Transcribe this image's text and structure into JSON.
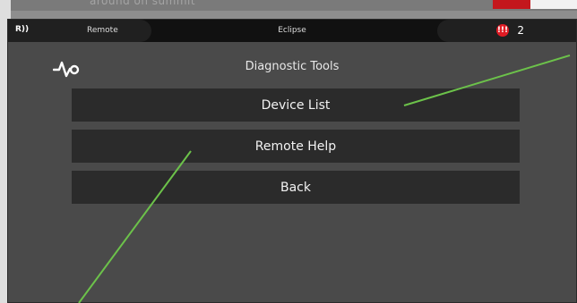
{
  "background_doc": {
    "title_fragment": "around on summit"
  },
  "status_bar": {
    "remote_icon": "R))",
    "remote_label": "Remote",
    "device_name": "Eclipse",
    "alert_icon": "!!!",
    "alert_count": "2"
  },
  "screen": {
    "title": "Diagnostic Tools",
    "title_icon": "pulse-icon",
    "buttons": [
      {
        "label": "Device List"
      },
      {
        "label": "Remote Help"
      },
      {
        "label": "Back"
      }
    ]
  },
  "colors": {
    "annotation_line": "#6cc24a",
    "alert": "#e01b24",
    "button_bg": "#2b2b2b",
    "screen_bg": "#4a4a4a"
  }
}
